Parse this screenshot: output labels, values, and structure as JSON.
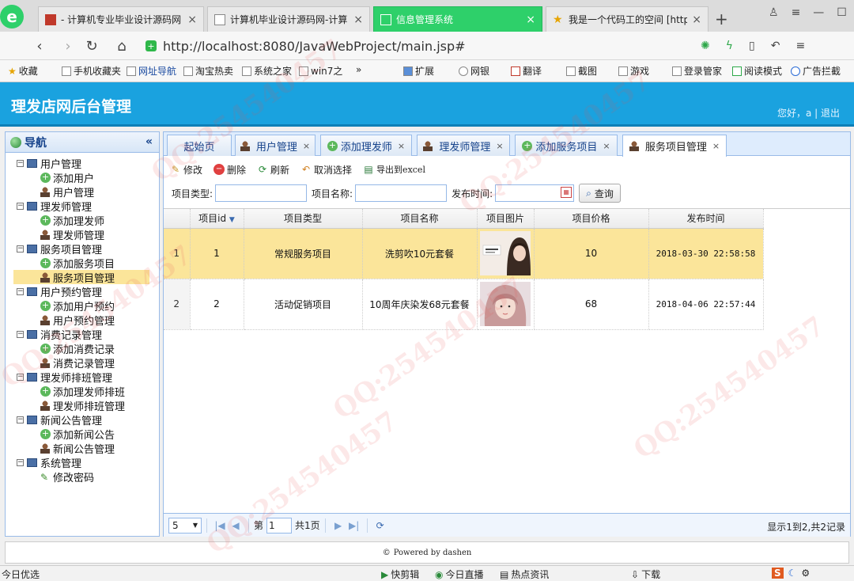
{
  "browser": {
    "tabs": [
      {
        "title": "- 计算机专业毕业设计源码网",
        "active": false
      },
      {
        "title": "计算机毕业设计源码网-计算",
        "active": false
      },
      {
        "title": "信息管理系统",
        "active": true
      },
      {
        "title": "我是一个代码工的空间 [http",
        "active": false
      }
    ],
    "new_tab": "+",
    "url": "http://localhost:8080/JavaWebProject/main.jsp#",
    "bookmarks": [
      "收藏",
      "手机收藏夹",
      "网址导航",
      "淘宝热卖",
      "系统之家",
      "win7之",
      "»",
      "扩展",
      "网银",
      "翻译",
      "截图",
      "游戏",
      "登录管家",
      "阅读模式",
      "广告拦截"
    ]
  },
  "app": {
    "title": "理发店网后台管理",
    "user_info": "您好，a | 退出"
  },
  "nav": {
    "title": "导航",
    "collapse": "«",
    "groups": [
      {
        "label": "用户管理",
        "items": [
          {
            "label": "添加用户",
            "icon": "add"
          },
          {
            "label": "用户管理",
            "icon": "user"
          }
        ]
      },
      {
        "label": "理发师管理",
        "items": [
          {
            "label": "添加理发师",
            "icon": "add"
          },
          {
            "label": "理发师管理",
            "icon": "user"
          }
        ]
      },
      {
        "label": "服务项目管理",
        "items": [
          {
            "label": "添加服务项目",
            "icon": "add"
          },
          {
            "label": "服务项目管理",
            "icon": "user",
            "selected": true
          }
        ]
      },
      {
        "label": "用户预约管理",
        "items": [
          {
            "label": "添加用户预约",
            "icon": "add"
          },
          {
            "label": "用户预约管理",
            "icon": "user"
          }
        ]
      },
      {
        "label": "消费记录管理",
        "items": [
          {
            "label": "添加消费记录",
            "icon": "add"
          },
          {
            "label": "消费记录管理",
            "icon": "user"
          }
        ]
      },
      {
        "label": "理发师排班管理",
        "items": [
          {
            "label": "添加理发师排班",
            "icon": "add"
          },
          {
            "label": "理发师排班管理",
            "icon": "user"
          }
        ]
      },
      {
        "label": "新闻公告管理",
        "items": [
          {
            "label": "添加新闻公告",
            "icon": "add"
          },
          {
            "label": "新闻公告管理",
            "icon": "user"
          }
        ]
      },
      {
        "label": "系统管理",
        "items": [
          {
            "label": "修改密码",
            "icon": "pen"
          }
        ]
      }
    ]
  },
  "content_tabs": [
    {
      "label": "起始页",
      "icon": "none",
      "closable": false
    },
    {
      "label": "用户管理",
      "icon": "user",
      "closable": true
    },
    {
      "label": "添加理发师",
      "icon": "add",
      "closable": true
    },
    {
      "label": "理发师管理",
      "icon": "user",
      "closable": true
    },
    {
      "label": "添加服务项目",
      "icon": "add",
      "closable": true
    },
    {
      "label": "服务项目管理",
      "icon": "user",
      "closable": true,
      "active": true
    }
  ],
  "toolbar": {
    "edit": "修改",
    "delete": "删除",
    "refresh": "刷新",
    "cancel_select": "取消选择",
    "export": "导出到excel"
  },
  "search": {
    "type_label": "项目类型:",
    "name_label": "项目名称:",
    "time_label": "发布时间:",
    "query": "查询"
  },
  "grid": {
    "columns": [
      "项目id",
      "项目类型",
      "项目名称",
      "项目图片",
      "项目价格",
      "发布时间"
    ],
    "rows": [
      {
        "rownum": "1",
        "id": "1",
        "type": "常规服务项目",
        "name": "洗剪吹10元套餐",
        "price": "10",
        "time": "2018-03-30 22:58:58",
        "selected": true
      },
      {
        "rownum": "2",
        "id": "2",
        "type": "活动促销项目",
        "name": "10周年庆染发68元套餐",
        "price": "68",
        "time": "2018-04-06 22:57:44",
        "selected": false
      }
    ]
  },
  "pager": {
    "page_size": "5",
    "page_prefix": "第",
    "page_value": "1",
    "page_total": "共1页",
    "info": "显示1到2,共2记录"
  },
  "footer": "Powered by dashen",
  "statusbar": {
    "left": "今日优选",
    "items": [
      "快剪辑",
      "今日直播",
      "热点资讯",
      "下载"
    ]
  },
  "colors": {
    "header": "#1aa2df",
    "selected_row": "#fbe59a",
    "active_browser_tab": "#2ed06a"
  }
}
